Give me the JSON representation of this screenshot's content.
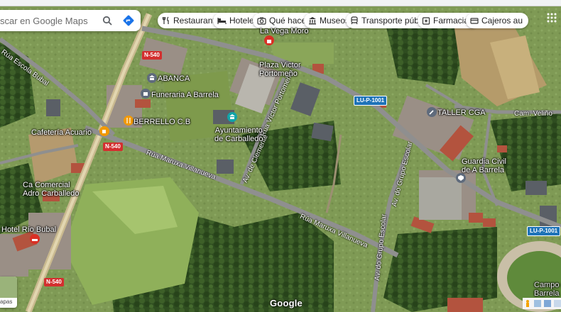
{
  "search": {
    "placeholder": "scar en Google Maps"
  },
  "chips": [
    {
      "label": "Restaurantes",
      "icon": "fork-knife-icon"
    },
    {
      "label": "Hoteles",
      "icon": "bed-icon"
    },
    {
      "label": "Qué hacer",
      "icon": "camera-icon"
    },
    {
      "label": "Museos",
      "icon": "museum-icon"
    },
    {
      "label": "Transporte público",
      "icon": "train-icon"
    },
    {
      "label": "Farmacias",
      "icon": "pharmacy-icon"
    },
    {
      "label": "Cajeros automátic",
      "icon": "atm-icon"
    }
  ],
  "places": {
    "la_vega_moro": "La Vega Moro",
    "plaza": "Plaza Victor\nPortomeño",
    "abanca": "ABANCA",
    "funeraria": "Funeraria A Barrela",
    "berrello": "BERRELLO C.B",
    "ayuntamiento": "Ayuntamiento\nde Carballedo",
    "cafeteria": "Cafetería Acuario",
    "comercial": "Ca Comercial\nAdro Carballedo",
    "hotel": "Hotel Río Bubal",
    "taller": "TALLER CGA",
    "guardia": "Guardia Civil\nde A Barrela",
    "campo": "Campo de\nBarrela"
  },
  "roads": {
    "escuela": "Rúa Escola Bubal",
    "maruxa1": "Rúa Maruxa Villanueva",
    "maruxa2": "Rúa Maruxa Villanueva",
    "victor": "Rúa Víctor Portomeño",
    "clemente": "Av. de Clemente",
    "grupo1": "Av. do Grupo Escolar",
    "grupo2": "Av. do Grupo Escolar",
    "velino": "Cam. Veliño"
  },
  "shields": {
    "n540_a": "N-540",
    "n540_b": "N-540",
    "n540_c": "N-540",
    "lup1": "LU-P-1001",
    "lup2": "LU-P-1001"
  },
  "footer": {
    "logo": "Google",
    "layers_caption": "apas"
  },
  "colors": {
    "accent": "#1a73e8",
    "pin_red": "#d93025",
    "pin_orange": "#f29900",
    "pin_gray": "#5f6b7c",
    "pin_teal": "#12a4a8"
  }
}
